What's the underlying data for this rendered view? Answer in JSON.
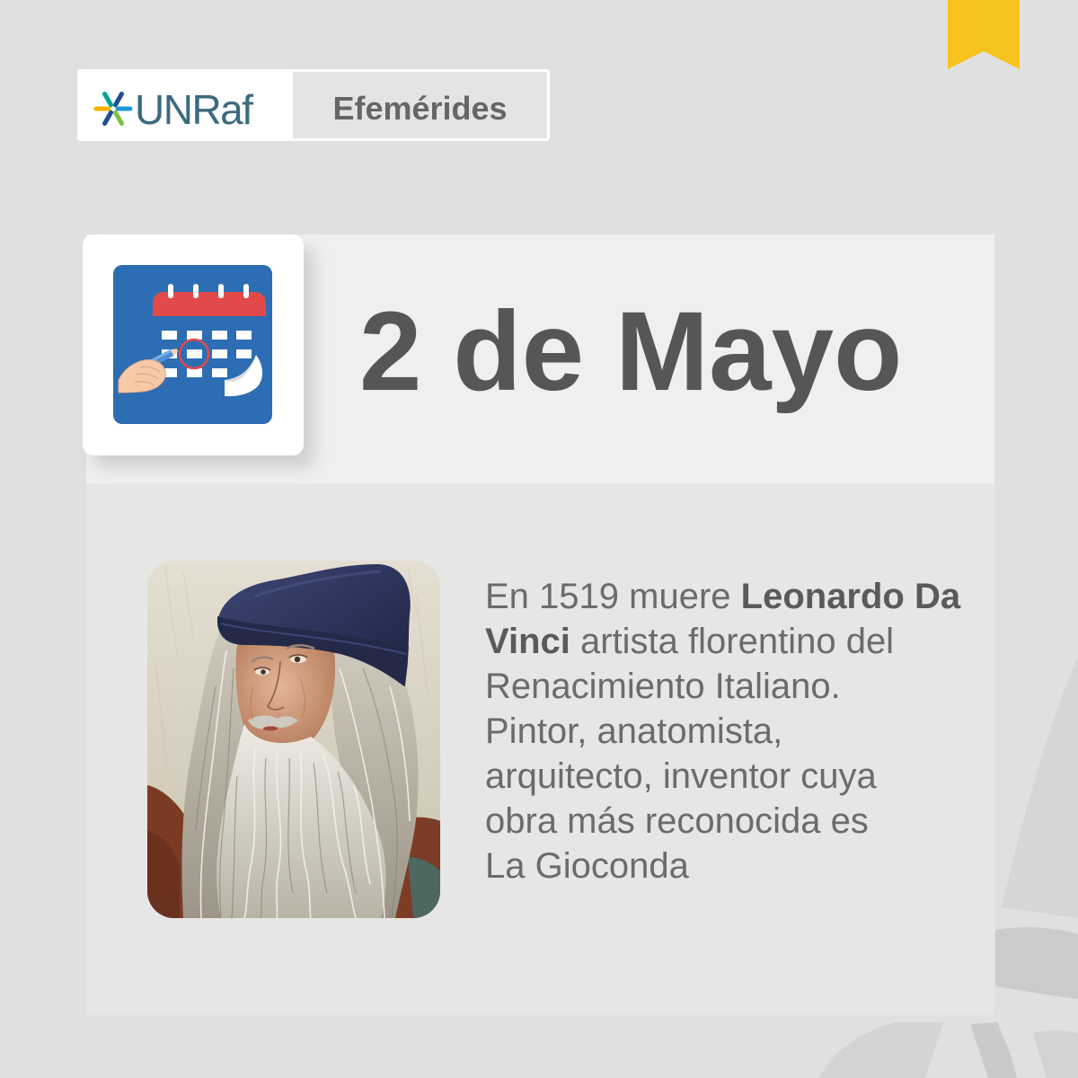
{
  "brand": {
    "logo_text": "UNRaf",
    "section_label": "Efemérides"
  },
  "date": {
    "title": "2 de Mayo"
  },
  "event": {
    "description": {
      "line1": {
        "regular": "En 1519 muere ",
        "bold": "Leonardo Da"
      },
      "line2": {
        "bold": "Vinci",
        "regular": " artista florentino del"
      },
      "line3": "Renacimiento Italiano.",
      "line4": "Pintor, anatomista,",
      "line5": "arquitecto, inventor cuya",
      "line6": "obra más reconocida es",
      "line7": "La Gioconda"
    }
  },
  "icons": {
    "bookmark": "bookmark-ribbon-icon",
    "logo": "unraf-asterisk-icon",
    "calendar": "calendar-with-hand-icon"
  },
  "colors": {
    "background": "#e0e0e0",
    "date_band": "#efefef",
    "content_panel": "#e6e6e6",
    "bookmark_yellow": "#f6c31c",
    "calendar_blue": "#2c6db3",
    "calendar_red": "#e24a4a",
    "title_text": "#565656",
    "body_text": "#6b6b6b",
    "body_bold": "#5a5a5a",
    "label_text": "#666666",
    "logo_text": "#3b6a80"
  }
}
